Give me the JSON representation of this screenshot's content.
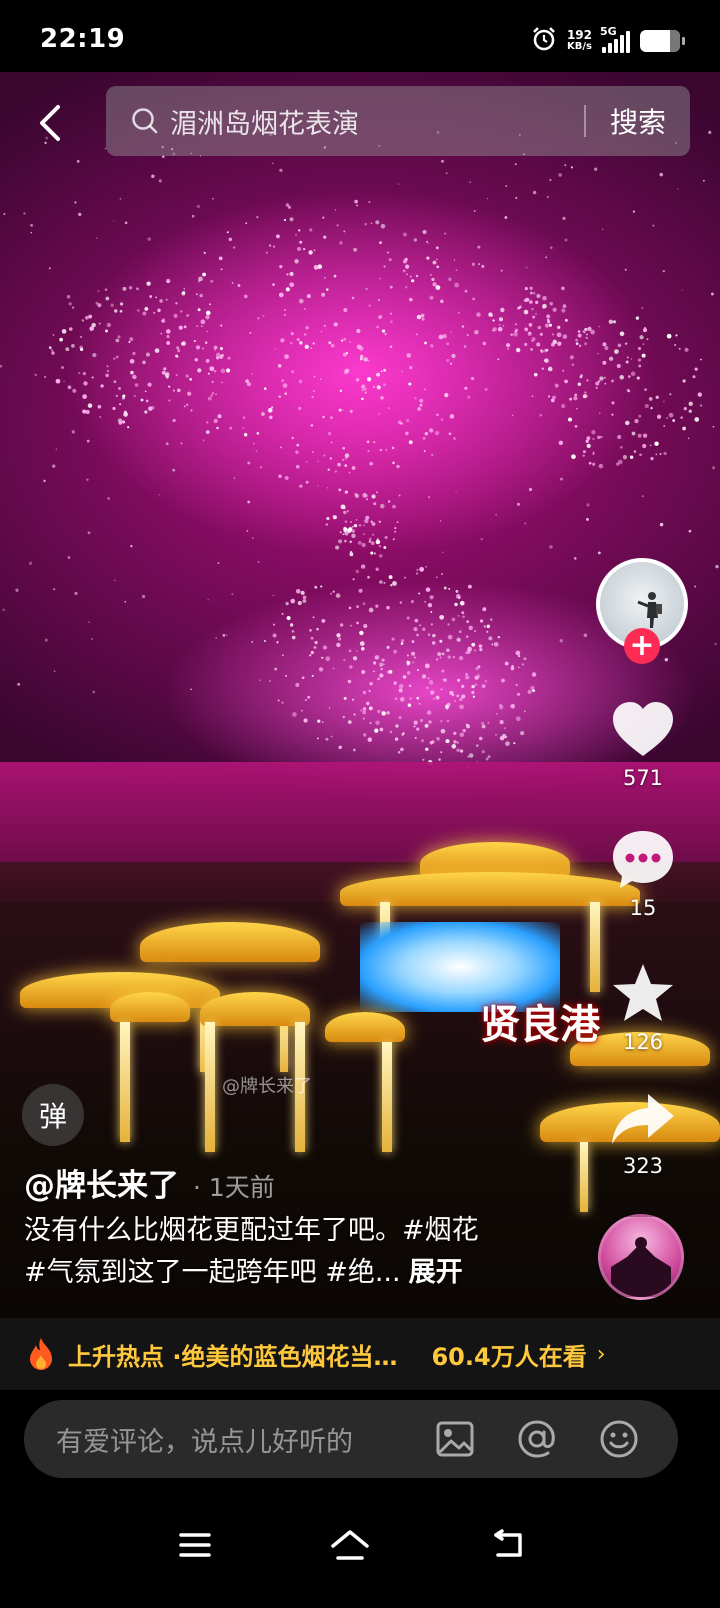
{
  "status_bar": {
    "time": "22:19",
    "net_speed_value": "192",
    "net_speed_unit": "KB/s",
    "network_type": "5G",
    "icons": [
      "alarm-icon",
      "signal-icon",
      "battery-icon"
    ]
  },
  "search": {
    "query": "湄洲岛烟花表演",
    "button_label": "搜索"
  },
  "video": {
    "watermark_location": "贤良港",
    "watermark_author": "@牌长来了"
  },
  "actions": {
    "likes": "571",
    "comments": "15",
    "favorites": "126",
    "shares": "323",
    "follow_symbol": "+"
  },
  "danmu": {
    "label": "弹"
  },
  "post": {
    "author": "@牌长来了",
    "time": "· 1天前",
    "caption_line1": "没有什么比烟花更配过年了吧。#烟花",
    "caption_line2": "#气氛到这了一起跨年吧 #绝...",
    "expand_label": "展开"
  },
  "hot_banner": {
    "label": "上升热点 · ",
    "title": "绝美的蓝色烟花当然要…",
    "viewers": "60.4万人在看",
    "chevron": "›",
    "accent_color": "#ffc83d"
  },
  "comment_bar": {
    "placeholder": "有爱评论，说点儿好听的",
    "icons": [
      "image-icon",
      "at-icon",
      "emoji-icon"
    ]
  },
  "nav": {
    "icons": [
      "menu-icon",
      "home-icon",
      "back-icon"
    ]
  },
  "colors": {
    "follow_red": "#fe2c55",
    "firework_magenta": "#e020b0"
  }
}
